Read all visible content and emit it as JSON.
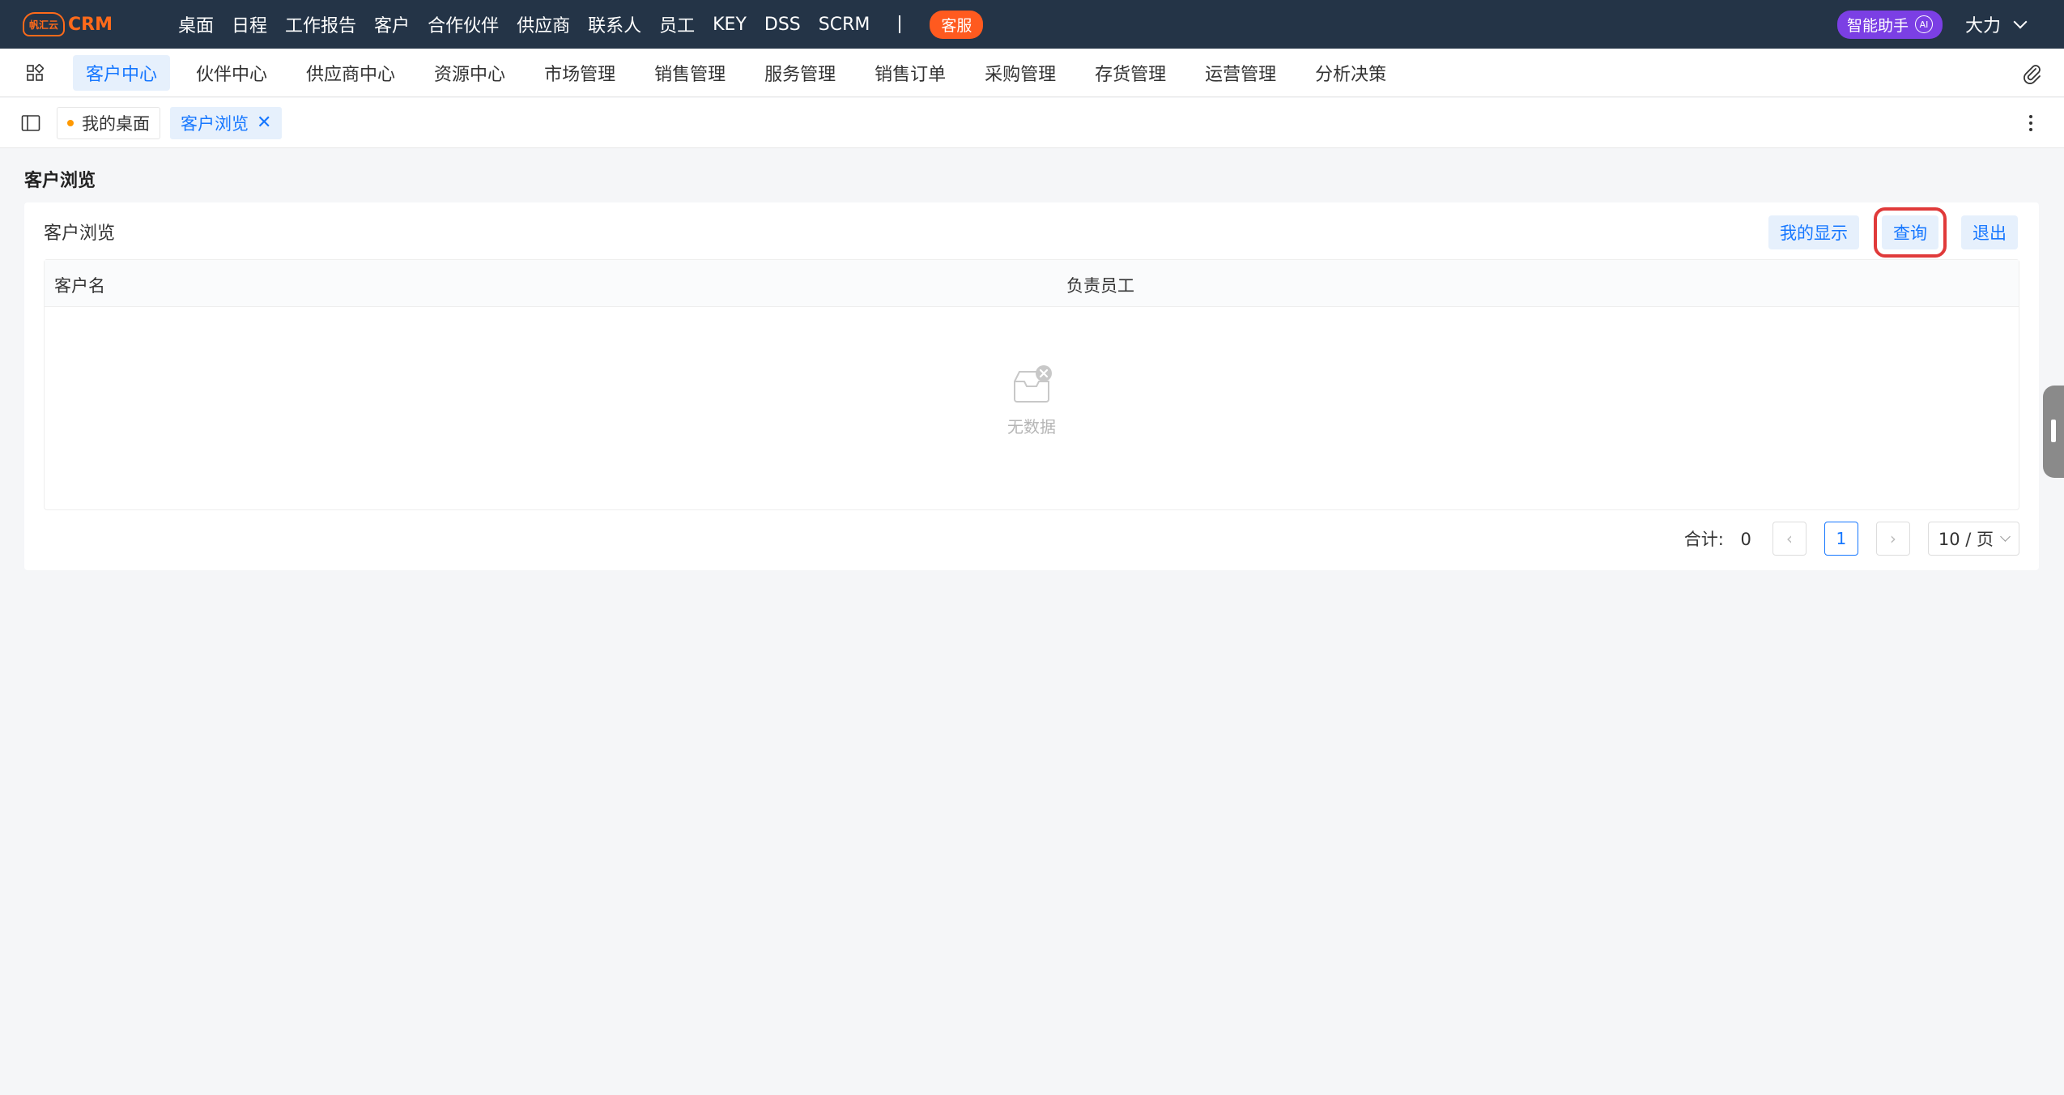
{
  "topbar": {
    "logo_badge": "帆汇云",
    "logo_text": "CRM",
    "nav": [
      "桌面",
      "日程",
      "工作报告",
      "客户",
      "合作伙伴",
      "供应商",
      "联系人",
      "员工",
      "KEY",
      "DSS",
      "SCRM"
    ],
    "kefu": "客服",
    "ai_assistant": "智能助手",
    "ai_badge": "AI",
    "user": "大力"
  },
  "modules": {
    "tabs": [
      "客户中心",
      "伙伴中心",
      "供应商中心",
      "资源中心",
      "市场管理",
      "销售管理",
      "服务管理",
      "销售订单",
      "采购管理",
      "存货管理",
      "运营管理",
      "分析决策"
    ],
    "active": "客户中心"
  },
  "page_tabs": {
    "desktop": "我的桌面",
    "current": "客户浏览",
    "close": "✕"
  },
  "page": {
    "title": "客户浏览",
    "panel_title": "客户浏览",
    "buttons": {
      "my_display": "我的显示",
      "query": "查询",
      "exit": "退出"
    },
    "columns": [
      "客户名",
      "负责员工"
    ],
    "empty_text": "无数据",
    "pager": {
      "total_label": "合计:",
      "total_value": "0",
      "current_page": "1",
      "page_size": "10 / 页",
      "prev": "‹",
      "next": "›"
    }
  },
  "colors": {
    "topbar_bg": "#243447",
    "accent": "#1677ff",
    "brand_orange": "#ff6a1a",
    "ai_purple": "#7b3fe4",
    "highlight_red": "#e03a3a"
  }
}
